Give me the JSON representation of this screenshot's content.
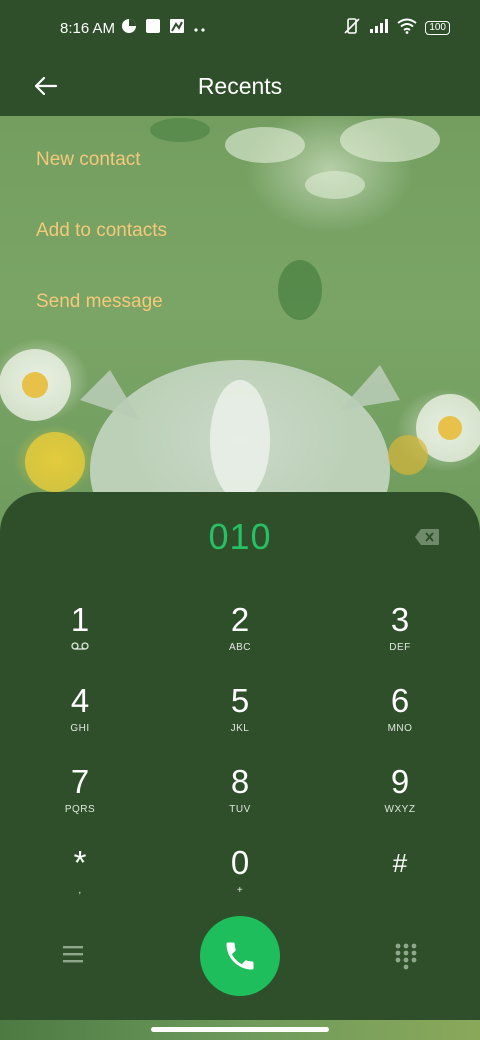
{
  "status_bar": {
    "time": "8:16 AM",
    "battery": "100",
    "icons": [
      "data-saver-icon",
      "square-icon",
      "image-icon",
      "more-dots-icon",
      "vibrate-off-icon",
      "signal-icon",
      "wifi-icon"
    ]
  },
  "header": {
    "title": "Recents",
    "back_icon": "arrow-left-icon"
  },
  "actions": {
    "new_contact": "New contact",
    "add_to_contacts": "Add to contacts",
    "send_message": "Send message"
  },
  "dialer": {
    "number": "010",
    "keys": [
      {
        "digit": "1",
        "letters": ""
      },
      {
        "digit": "2",
        "letters": "ABC"
      },
      {
        "digit": "3",
        "letters": "DEF"
      },
      {
        "digit": "4",
        "letters": "GHI"
      },
      {
        "digit": "5",
        "letters": "JKL"
      },
      {
        "digit": "6",
        "letters": "MNO"
      },
      {
        "digit": "7",
        "letters": "PQRS"
      },
      {
        "digit": "8",
        "letters": "TUV"
      },
      {
        "digit": "9",
        "letters": "WXYZ"
      },
      {
        "digit": "*",
        "letters": ","
      },
      {
        "digit": "0",
        "letters": "+"
      },
      {
        "digit": "#",
        "letters": ""
      }
    ]
  },
  "colors": {
    "background": "#2e4f2a",
    "accent_green": "#27c064",
    "call_button": "#1fbe5c",
    "action_text": "#f4c97a"
  }
}
